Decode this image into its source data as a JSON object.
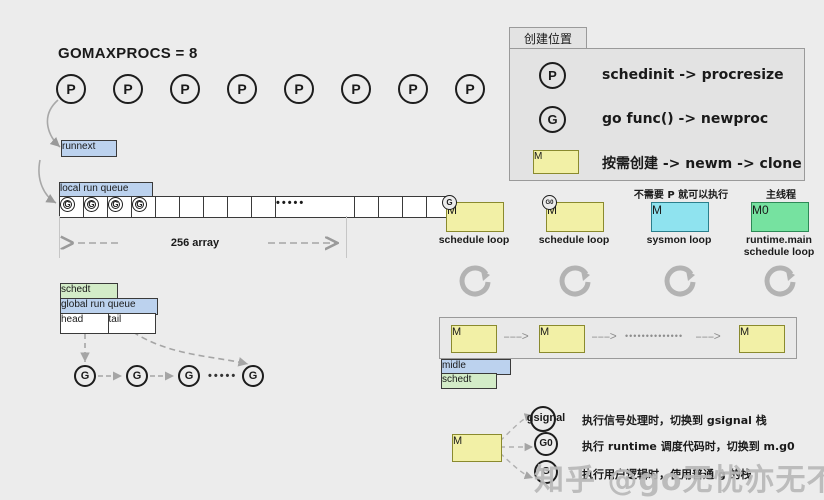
{
  "left": {
    "title": "GOMAXPROCS = 8",
    "p_label": "P",
    "p_count": 8,
    "runnext_label": "runnext",
    "local_queue_label": "local run queue",
    "g_label": "G",
    "queue_filled": 4,
    "queue_dots": "•••••",
    "array_label": "256 array",
    "schedt_label": "schedt",
    "global_queue_label": "global run queue",
    "head_label": "head",
    "tail_label": "tail",
    "glist_dots": "•••••"
  },
  "panel": {
    "tab_label": "创建位置",
    "rows": [
      {
        "badge": "P",
        "badge_type": "circle",
        "text": "schedinit -> procresize"
      },
      {
        "badge": "G",
        "badge_type": "circle",
        "text": "go func() -> newproc"
      },
      {
        "badge": "M",
        "badge_type": "yellow-box",
        "text": "按需创建 ->  newm ->  clone"
      }
    ]
  },
  "threads": {
    "items": [
      {
        "box_label": "M",
        "box_color": "yellow",
        "corner": "G",
        "note": "",
        "caption": "schedule loop"
      },
      {
        "box_label": "M",
        "box_color": "yellow",
        "corner": "G0",
        "note": "",
        "caption": "schedule loop"
      },
      {
        "box_label": "M",
        "box_color": "cyan",
        "corner": "",
        "note": "不需要 P 就可以执行",
        "caption": "sysmon loop"
      },
      {
        "box_label": "M0",
        "box_color": "green",
        "corner": "",
        "note": "主线程",
        "caption": "runtime.main\nschedule loop"
      }
    ]
  },
  "mlist": {
    "boxes": [
      "M",
      "M",
      "M"
    ],
    "arrow": "–––>",
    "dots": "••••••••••••••",
    "midle_label": "midle",
    "schedt_label": "schedt"
  },
  "stacks": {
    "m_label": "M",
    "rows": [
      {
        "label": "gsignal",
        "text": "执行信号处理时，切换到 gsignal 栈"
      },
      {
        "label": "G0",
        "text": "执行 runtime 调度代码时，切换到 m.g0"
      },
      {
        "label": "G",
        "text": "执行用户逻辑时，使用普通 g 的栈"
      }
    ]
  },
  "watermark": {
    "text": "知乎 @go无忧亦无不怖"
  },
  "colors": {
    "background": "#ececec",
    "yellow": "#f2f0a6",
    "cyan": "#8fe3ef",
    "green": "#76e2a0",
    "label_blue": "#bcd2ee",
    "label_green": "#d3ecc8",
    "panel": "#e3e3e3",
    "arrow_gray": "#9a9a9a"
  }
}
